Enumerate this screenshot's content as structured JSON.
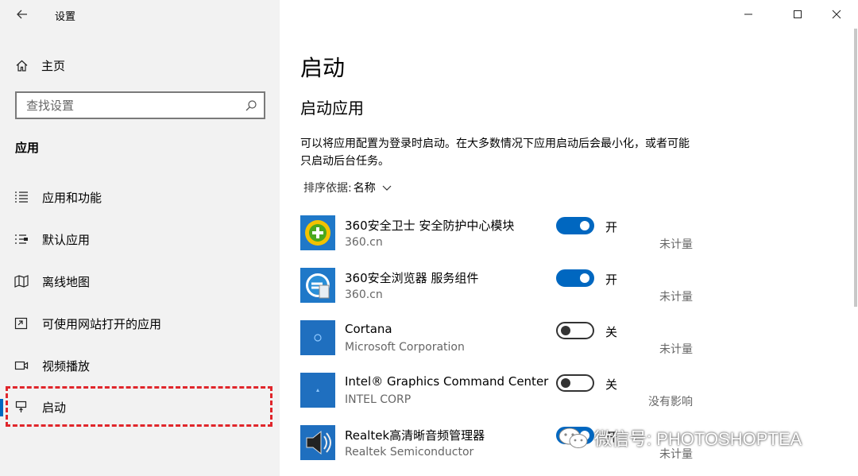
{
  "window": {
    "title": "设置"
  },
  "sidebar": {
    "home_label": "主页",
    "search_placeholder": "查找设置",
    "section_heading": "应用",
    "items": [
      {
        "label": "应用和功能",
        "icon": "list-icon"
      },
      {
        "label": "默认应用",
        "icon": "default-apps-icon"
      },
      {
        "label": "离线地图",
        "icon": "map-icon"
      },
      {
        "label": "可使用网站打开的应用",
        "icon": "open-website-icon"
      },
      {
        "label": "视频播放",
        "icon": "video-icon"
      },
      {
        "label": "启动",
        "icon": "startup-icon",
        "selected": true
      }
    ]
  },
  "main": {
    "title": "启动",
    "subtitle": "启动应用",
    "description": "可以将应用配置为登录时启动。在大多数情况下应用启动后会最小化，或者可能只启动后台任务。",
    "sort_label": "排序依据:",
    "sort_value": "名称",
    "apps": [
      {
        "name": "360安全卫士 安全防护中心模块",
        "publisher": "360.cn",
        "state": "开",
        "on": true,
        "impact": "未计量",
        "icon": "360-safe-icon"
      },
      {
        "name": "360安全浏览器 服务组件",
        "publisher": "360.cn",
        "state": "开",
        "on": true,
        "impact": "未计量",
        "icon": "360-browser-icon"
      },
      {
        "name": "Cortana",
        "publisher": "Microsoft Corporation",
        "state": "关",
        "on": false,
        "impact": "未计量",
        "icon": "cortana-icon"
      },
      {
        "name": "Intel® Graphics Command Center S...",
        "publisher": "INTEL CORP",
        "state": "关",
        "on": false,
        "impact": "没有影响",
        "icon": "intel-icon"
      },
      {
        "name": "Realtek高清晰音频管理器",
        "publisher": "Realtek Semiconductor",
        "state": "开",
        "on": true,
        "impact": "未计量",
        "icon": "speaker-icon"
      }
    ]
  },
  "watermark": {
    "text": "微信号: PHOTOSHOPTEA"
  },
  "colors": {
    "accent": "#0067c0",
    "highlight": "#e0262b",
    "sidebar_bg": "#f2f2f2"
  }
}
